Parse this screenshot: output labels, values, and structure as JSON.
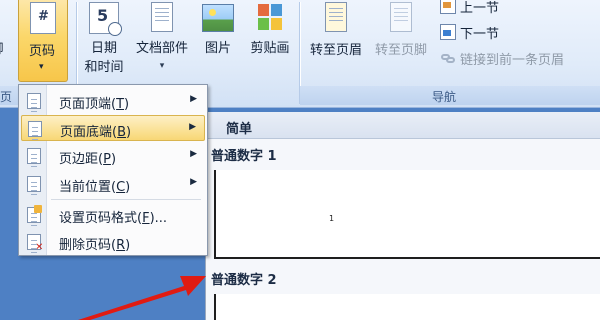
{
  "ribbon": {
    "left_partial_label": "脚",
    "page_number": {
      "label": "页码",
      "caret": "▾",
      "glyph": "#"
    },
    "date_time": {
      "line1": "日期",
      "line2": "和时间",
      "glyph": "5"
    },
    "doc_parts": {
      "label": "文档部件",
      "caret": "▾"
    },
    "picture": {
      "label": "图片"
    },
    "clip_art": {
      "label": "剪贴画"
    },
    "goto_header": {
      "label": "转至页眉"
    },
    "goto_footer": {
      "label": "转至页脚"
    },
    "prev_section": {
      "label": "上一节"
    },
    "next_section": {
      "label": "下一节"
    },
    "link_previous": {
      "label": "链接到前一条页眉"
    },
    "groups": {
      "left_partial": "页",
      "nav": "导航"
    }
  },
  "menu": {
    "items": [
      {
        "label": "页面顶端",
        "key": "T",
        "submenu": true
      },
      {
        "label": "页面底端",
        "key": "B",
        "submenu": true,
        "highlighted": true
      },
      {
        "label": "页边距",
        "key": "P",
        "submenu": true
      },
      {
        "label": "当前位置",
        "key": "C",
        "submenu": true
      },
      {
        "label": "设置页码格式",
        "key": "F",
        "suffix": "...",
        "submenu": false
      },
      {
        "label": "删除页码",
        "key": "R",
        "submenu": false
      }
    ],
    "arrow": "▶"
  },
  "gallery": {
    "header": "简单",
    "items": [
      {
        "title": "普通数字 1",
        "page_num": "1"
      },
      {
        "title": "普通数字 2"
      }
    ]
  },
  "colors": {
    "accent_highlight": "#f8d775",
    "ribbon_bg": "#e0ebf9",
    "doc_bg": "#4e80c4",
    "arrow_red": "#e01b12"
  }
}
